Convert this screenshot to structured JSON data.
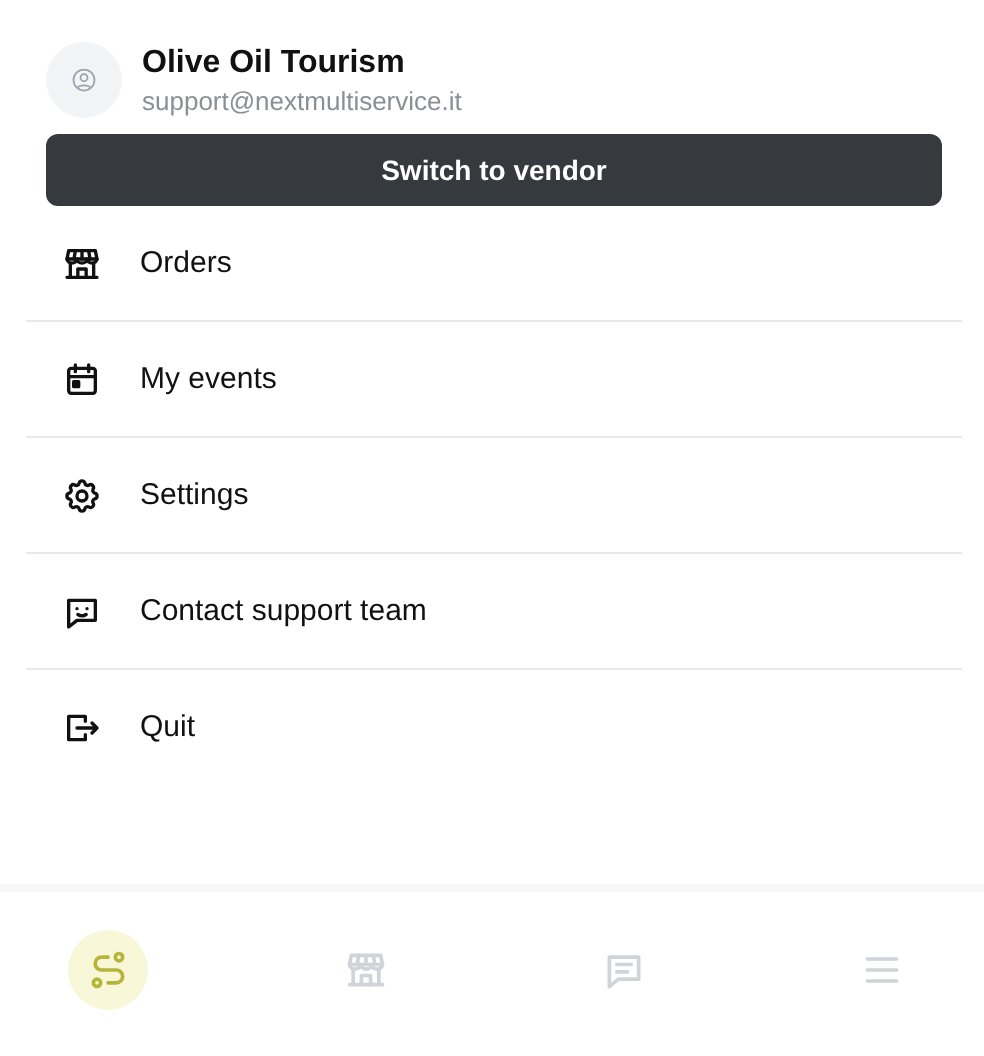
{
  "user": {
    "name": "Olive Oil Tourism",
    "email": "support@nextmultiservice.it"
  },
  "switch_button": {
    "label": "Switch to vendor"
  },
  "menu": [
    {
      "label": "Orders"
    },
    {
      "label": "My events"
    },
    {
      "label": "Settings"
    },
    {
      "label": "Contact support team"
    },
    {
      "label": "Quit"
    }
  ],
  "bottom_nav": [
    {
      "selected": true
    },
    {
      "selected": false
    },
    {
      "selected": false
    },
    {
      "selected": false
    }
  ]
}
